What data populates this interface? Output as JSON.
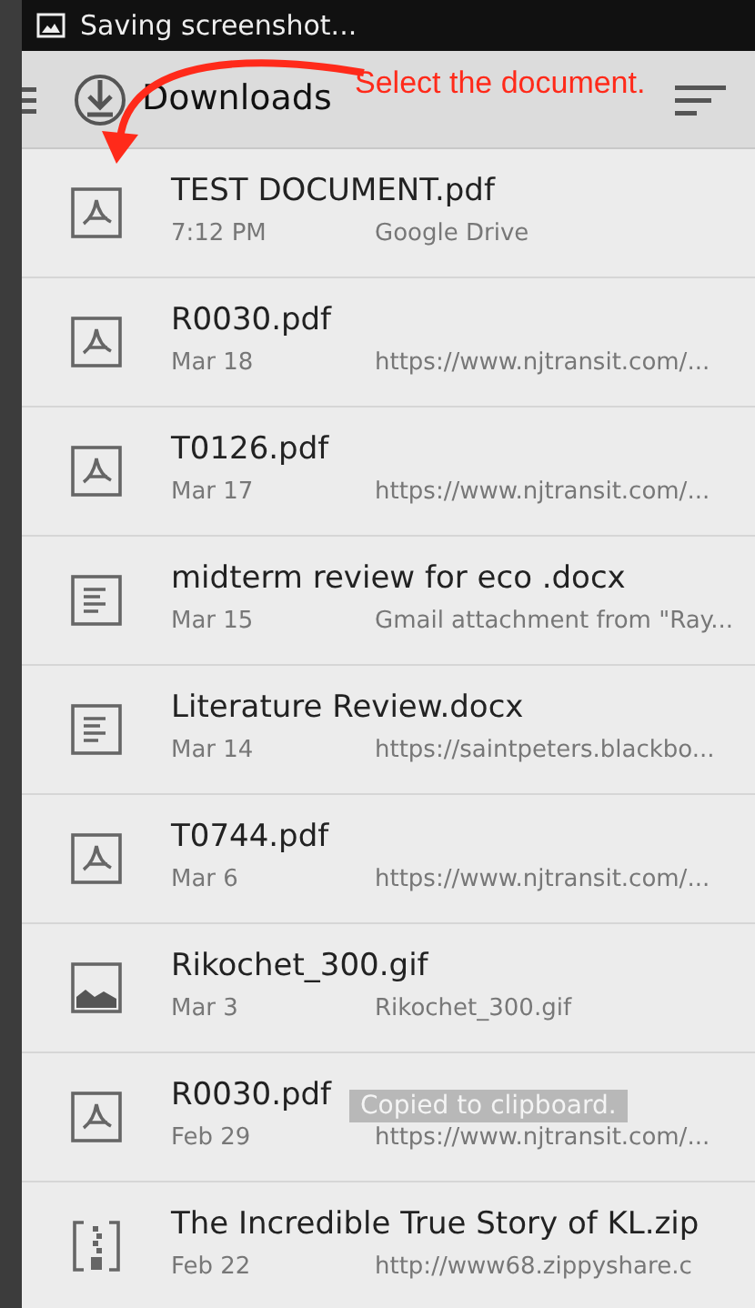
{
  "status_bar": {
    "text": "Saving screenshot..."
  },
  "app_bar": {
    "title": "Downloads"
  },
  "annotation": {
    "text": "Select the document."
  },
  "files": [
    {
      "kind": "pdf",
      "name": "TEST DOCUMENT.pdf",
      "date": "7:12 PM",
      "source": "Google Drive"
    },
    {
      "kind": "pdf",
      "name": "R0030.pdf",
      "date": "Mar 18",
      "source": "https://www.njtransit.com/..."
    },
    {
      "kind": "pdf",
      "name": "T0126.pdf",
      "date": "Mar 17",
      "source": "https://www.njtransit.com/..."
    },
    {
      "kind": "doc",
      "name": "midterm review for eco .docx",
      "date": "Mar 15",
      "source": "Gmail attachment from \"Ray..."
    },
    {
      "kind": "doc",
      "name": "Literature Review.docx",
      "date": "Mar 14",
      "source": "https://saintpeters.blackbo..."
    },
    {
      "kind": "pdf",
      "name": "T0744.pdf",
      "date": "Mar 6",
      "source": "https://www.njtransit.com/..."
    },
    {
      "kind": "image",
      "name": "Rikochet_300.gif",
      "date": "Mar 3",
      "source": "Rikochet_300.gif"
    },
    {
      "kind": "pdf",
      "name": "R0030.pdf",
      "date": "Feb 29",
      "source": "https://www.njtransit.com/..."
    },
    {
      "kind": "zip",
      "name": "The Incredible True Story of KL.zip",
      "date": "Feb 22",
      "source": "http://www68.zippyshare.c"
    }
  ],
  "toast": {
    "text": "Copied to clipboard."
  }
}
